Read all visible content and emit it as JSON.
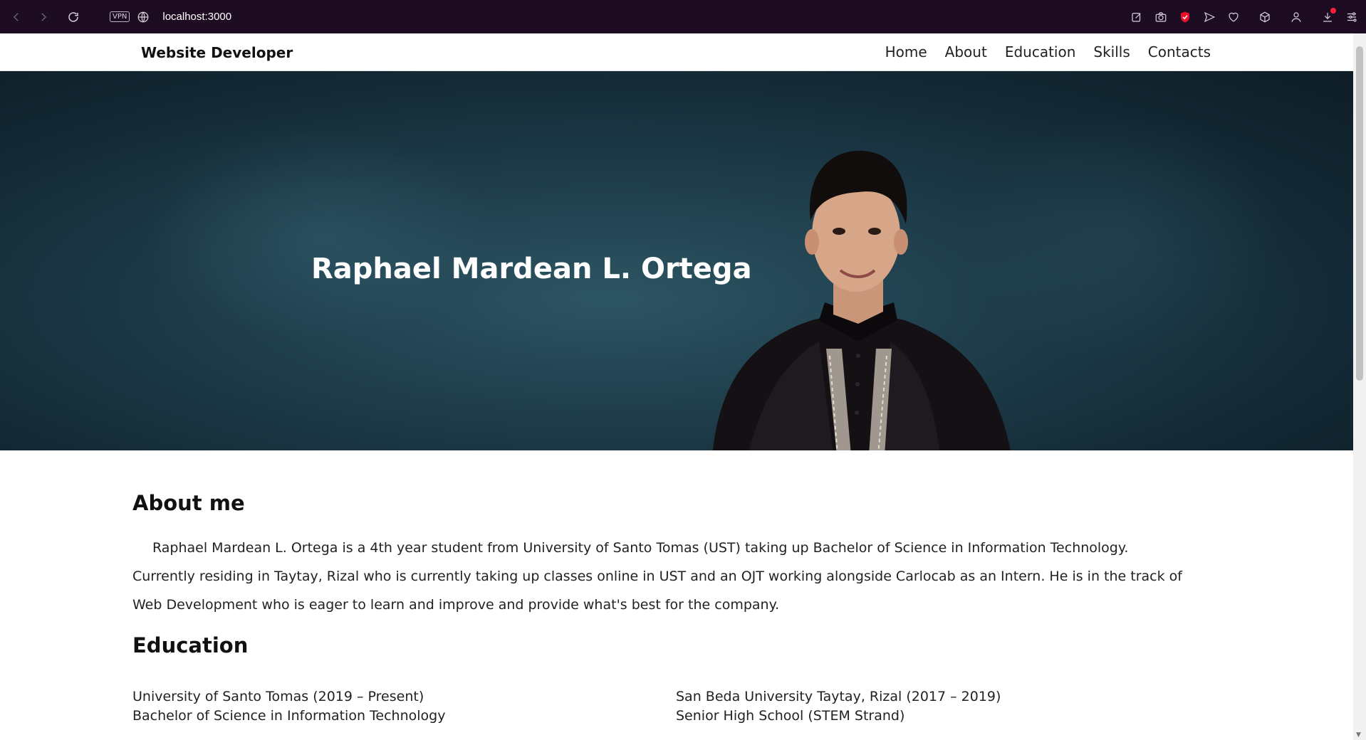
{
  "browser": {
    "url": "localhost:3000",
    "vpn_label": "VPN"
  },
  "navbar": {
    "brand": "Website Developer",
    "items": [
      "Home",
      "About",
      "Education",
      "Skills",
      "Contacts"
    ]
  },
  "hero": {
    "title": "Raphael Mardean L. Ortega"
  },
  "about": {
    "heading": "About me",
    "text": "Raphael Mardean L. Ortega is a 4th year student from University of Santo Tomas (UST) taking up Bachelor of Science in Information Technology. Currently residing in Taytay, Rizal who is currently taking up classes online in UST and an OJT working alongside Carlocab as an Intern. He is in the track of Web Development who is eager to learn and improve and provide what's best for the company."
  },
  "education": {
    "heading": "Education",
    "entries": [
      {
        "school": "University of Santo Tomas (2019 – Present)",
        "program": "Bachelor of Science in Information Technology"
      },
      {
        "school": "San Beda University Taytay, Rizal (2017 – 2019)",
        "program": "Senior High School (STEM Strand)"
      }
    ]
  },
  "colors": {
    "chrome_bg": "#1e0c22",
    "hero_bg": "#1f3e4c",
    "shield_red": "#e8132b"
  }
}
